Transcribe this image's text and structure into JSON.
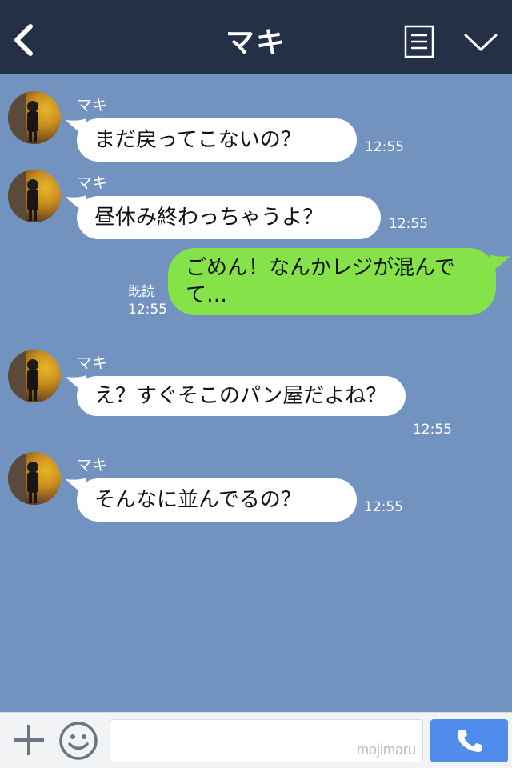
{
  "header": {
    "title": "マキ"
  },
  "contact_name": "マキ",
  "messages": [
    {
      "side": "in",
      "text": "まだ戻ってこないの？",
      "time": "12:55"
    },
    {
      "side": "in",
      "text": "昼休み終わっちゃうよ？",
      "time": "12:55"
    },
    {
      "side": "out",
      "text": "ごめん！なんかレジが混んでて…",
      "status": "既読",
      "time": "12:55"
    },
    {
      "side": "in",
      "text": "え？すぐそこのパン屋だよね？",
      "time": "12:55"
    },
    {
      "side": "in",
      "text": "そんなに並んでるの？",
      "time": "12:55"
    }
  ],
  "input": {
    "placeholder": "",
    "watermark": "mojimaru"
  },
  "colors": {
    "header_bg": "#243045",
    "chat_bg": "#7292c0",
    "incoming_bubble": "#ffffff",
    "outgoing_bubble": "#85e249",
    "call_button": "#4f8ceb"
  },
  "icons": {
    "back": "chevron-left-icon",
    "menu": "list-icon",
    "collapse": "chevron-down-icon",
    "plus": "plus-icon",
    "emoji": "smiley-icon",
    "call": "phone-icon"
  }
}
